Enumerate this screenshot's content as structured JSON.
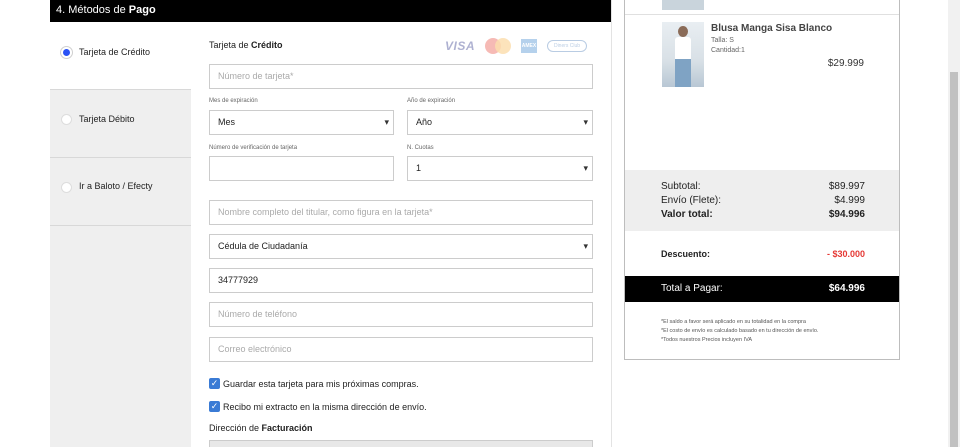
{
  "payment": {
    "step_number": "4. Métodos de ",
    "step_bold": "Pago",
    "methods": [
      {
        "label": "Tarjeta de Crédito",
        "selected": true
      },
      {
        "label": "Tarjeta Débito",
        "selected": false
      },
      {
        "label": "Ir a Baloto / Efecty",
        "selected": false
      }
    ],
    "form_title_prefix": "Tarjeta de ",
    "form_title_bold": "Crédito",
    "card_brands": [
      "VISA",
      "mastercard-icon",
      "AMEX",
      "Diners Club"
    ],
    "card_number_placeholder": "Número de tarjeta*",
    "exp_month_label": "Mes de expiración",
    "exp_month_value": "Mes",
    "exp_year_label": "Año de expiración",
    "exp_year_value": "Año",
    "cvv_label": "Número de verificación de tarjeta",
    "installments_label": "N. Cuotas",
    "installments_value": "1",
    "holder_placeholder": "Nombre completo del titular, como figura en la tarjeta*",
    "doc_type_value": "Cédula de Ciudadanía",
    "doc_number_value": "34777929",
    "phone_placeholder": "Número de teléfono",
    "email_placeholder": "Correo electrónico",
    "save_card_label": "Guardar esta tarjeta para mis próximas compras.",
    "same_address_label": "Recibo mi extracto en la misma dirección de envío.",
    "billing_prefix": "Dirección de ",
    "billing_bold": "Facturación"
  },
  "summary": {
    "product": {
      "name": "Blusa Manga Sisa Blanco",
      "size": "Talla: S",
      "quantity": "Cantidad:1",
      "price": "$29.999"
    },
    "subtotal_label": "Subtotal:",
    "subtotal_value": "$89.997",
    "shipping_label": "Envío (Flete):",
    "shipping_value": "$4.999",
    "total_label": "Valor total:",
    "total_value": "$94.996",
    "discount_label": "Descuento:",
    "discount_value": "- $30.000",
    "grand_label": "Total a Pagar:",
    "grand_value": "$64.996",
    "notes": [
      "*El saldo a favor será aplicado en su totalidad en la compra",
      "*El costo de envío es calculado basado en tu dirección de envío.",
      "*Todos nuestros Precios incluyen IVA"
    ]
  },
  "colors": {
    "accent_radio": "#2a52f5",
    "checkbox": "#3a7bd5",
    "discount": "#e53935"
  }
}
